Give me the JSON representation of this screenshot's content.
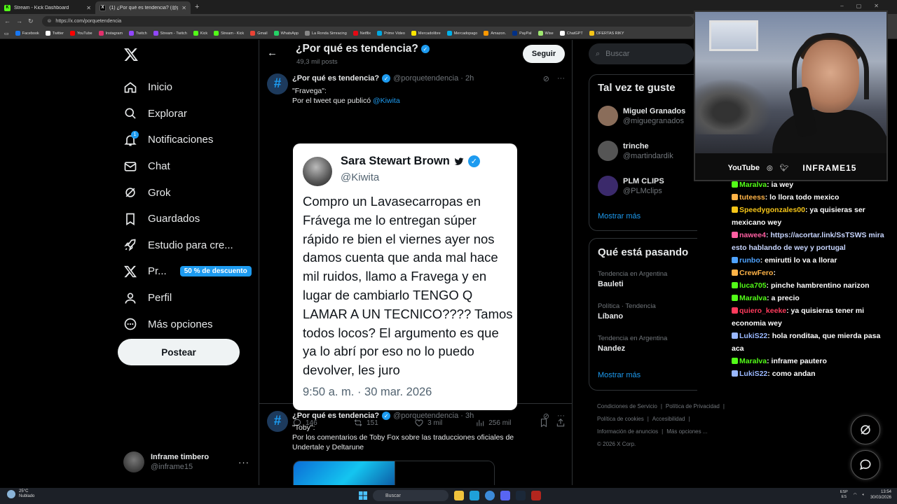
{
  "browser": {
    "tabs": [
      {
        "label": "Stream - Kick Dashboard",
        "icon_color": "#53fc18"
      },
      {
        "label": "(1) ¿Por qué es tendencia? (@porq",
        "icon_color": "#ffffff"
      }
    ],
    "url": "https://x.com/porquetendencia",
    "bookmarks": [
      {
        "label": "Facebook",
        "color": "#1877f2"
      },
      {
        "label": "Twitter",
        "color": "#ffffff"
      },
      {
        "label": "YouTube",
        "color": "#ff0000"
      },
      {
        "label": "Instagram",
        "color": "#e1306c"
      },
      {
        "label": "Twitch",
        "color": "#9146ff"
      },
      {
        "label": "Stream - Twitch",
        "color": "#9146ff"
      },
      {
        "label": "Kick",
        "color": "#53fc18"
      },
      {
        "label": "Stream - Kick",
        "color": "#53fc18"
      },
      {
        "label": "Gmail",
        "color": "#ea4335"
      },
      {
        "label": "WhatsApp",
        "color": "#25d366"
      },
      {
        "label": "La Ronda Simracing",
        "color": "#888888"
      },
      {
        "label": "Netflix",
        "color": "#e50914"
      },
      {
        "label": "Prime Video",
        "color": "#00a8e1"
      },
      {
        "label": "Mercadolibre",
        "color": "#ffe600"
      },
      {
        "label": "Mercadopago",
        "color": "#00b1ea"
      },
      {
        "label": "Amazon.",
        "color": "#ff9900"
      },
      {
        "label": "PayPal",
        "color": "#003087"
      },
      {
        "label": "Wise",
        "color": "#9fe870"
      },
      {
        "label": "ChatGPT",
        "color": "#ffffff"
      },
      {
        "label": "OFERTAS RIKY",
        "color": "#f5c518"
      }
    ]
  },
  "nav": {
    "items": [
      {
        "label": "Inicio",
        "icon": "home-icon"
      },
      {
        "label": "Explorar",
        "icon": "search-icon"
      },
      {
        "label": "Notificaciones",
        "icon": "bell-icon",
        "badge": "1"
      },
      {
        "label": "Chat",
        "icon": "mail-icon"
      },
      {
        "label": "Grok",
        "icon": "grok-icon"
      },
      {
        "label": "Guardados",
        "icon": "bookmark-icon"
      },
      {
        "label": "Estudio para cre...",
        "icon": "rocket-icon"
      },
      {
        "label": "Pr...",
        "icon": "x-icon",
        "badge_text": "50 % de descuento"
      },
      {
        "label": "Perfil",
        "icon": "user-icon"
      },
      {
        "label": "Más opciones",
        "icon": "more-circle-icon"
      }
    ],
    "post_label": "Postear",
    "account": {
      "name": "Inframe timbero",
      "handle": "@inframe15"
    }
  },
  "main": {
    "title": "¿Por qué es tendencia?",
    "subtitle": "49,3 mil posts",
    "follow_label": "Seguir",
    "tweets": [
      {
        "name": "¿Por qué es tendencia?",
        "handle": "@porquetendencia · 2h",
        "text_line1": "\"Fravega\":",
        "text_line2_prefix": "Por el tweet que publicó ",
        "text_mention": "@Kiwita",
        "card": {
          "name": "Sara Stewart Brown",
          "handle": "@Kiwita",
          "text": "Compro un Lavasecarropas en Frávega me lo entregan súper rápido re bien el viernes ayer nos damos cuenta que anda mal hace mil ruidos, llamo a Fravega y en lugar de cambiarlo TENGO Q LAMAR A UN TECNICO???? Tamos todos locos? El argumento es que ya lo abrí por eso no lo puedo devolver, les juro",
          "date": "9:50 a. m. · 30 mar. 2026"
        },
        "stats": {
          "replies": "146",
          "reposts": "151",
          "likes": "3 mil",
          "views": "256 mil"
        }
      },
      {
        "name": "¿Por qué es tendencia?",
        "handle": "@porquetendencia · 3h",
        "text_line1": "\"Toby\":",
        "text_line2": "Por los comentarios de Toby Fox sobre las traducciones oficiales de Undertale y Deltarune"
      }
    ]
  },
  "right": {
    "search_placeholder": "Buscar",
    "suggest_title": "Tal vez te guste",
    "suggestions": [
      {
        "name": "Miguel Granados",
        "handle": "@miguegranados",
        "color": "#8a6d5a"
      },
      {
        "name": "trinche",
        "handle": "@martindardik",
        "color": "#555555"
      },
      {
        "name": "PLM CLIPS",
        "handle": "@PLMclips",
        "color": "#3b2a6b"
      }
    ],
    "show_more": "Mostrar más",
    "trends_title": "Qué está pasando",
    "trends": [
      {
        "meta": "Tendencia en Argentina",
        "name": "Bauleti"
      },
      {
        "meta": "Política · Tendencia",
        "name": "Líbano"
      },
      {
        "meta": "Tendencia en Argentina",
        "name": "Nandez"
      }
    ],
    "footer": {
      "line1": [
        "Condiciones de Servicio",
        "|",
        "Política de Privacidad",
        "|"
      ],
      "line2": [
        "Política de cookies",
        "|",
        "Accesibilidad",
        "|"
      ],
      "line3": [
        "Información de anuncios",
        "|",
        "Más opciones ..."
      ],
      "line4": "© 2026 X Corp."
    }
  },
  "webcam": {
    "youtube": "YouTube",
    "brand": "INFRAME15"
  },
  "chat": [
    {
      "user": "Maralva",
      "color": "#53fc18",
      "msg": ": ia wey"
    },
    {
      "user": "tuteess",
      "color": "#ffb347",
      "msg": ": lo llora todo mexico"
    },
    {
      "user": "Speedygonzales00",
      "color": "#f5c518",
      "msg": ": ya quisieras ser mexicano wey"
    },
    {
      "user": "nawee4",
      "color": "#ff5fa2",
      "msg": ": https://acortar.link/SsTSWS mira esto hablando de wey y portugal",
      "link": true
    },
    {
      "user": "runbo",
      "color": "#4fa3ff",
      "msg": ": emirutti lo va a llorar"
    },
    {
      "user": "CrewFero",
      "color": "#ffb347",
      "msg": ":"
    },
    {
      "user": "luca705",
      "color": "#53fc18",
      "msg": ": pinche hambrentino narizon"
    },
    {
      "user": "Maralva",
      "color": "#53fc18",
      "msg": ": a precio"
    },
    {
      "user": "quiero_keeke",
      "color": "#ff3b5c",
      "msg": ": ya quisieras tener mi economia wey"
    },
    {
      "user": "LukiS22",
      "color": "#9ab8ff",
      "msg": ": hola ronditaa, que mierda pasa aca"
    },
    {
      "user": "Maralva",
      "color": "#53fc18",
      "msg": ": inframe pautero"
    },
    {
      "user": "LukiS22",
      "color": "#9ab8ff",
      "msg": ": como andan"
    }
  ],
  "taskbar": {
    "temp": "25°C",
    "weather": "Nublado",
    "search": "Buscar",
    "lang1": "ESP",
    "lang2": "ES",
    "time": "13:54",
    "date": "30/03/2026"
  }
}
